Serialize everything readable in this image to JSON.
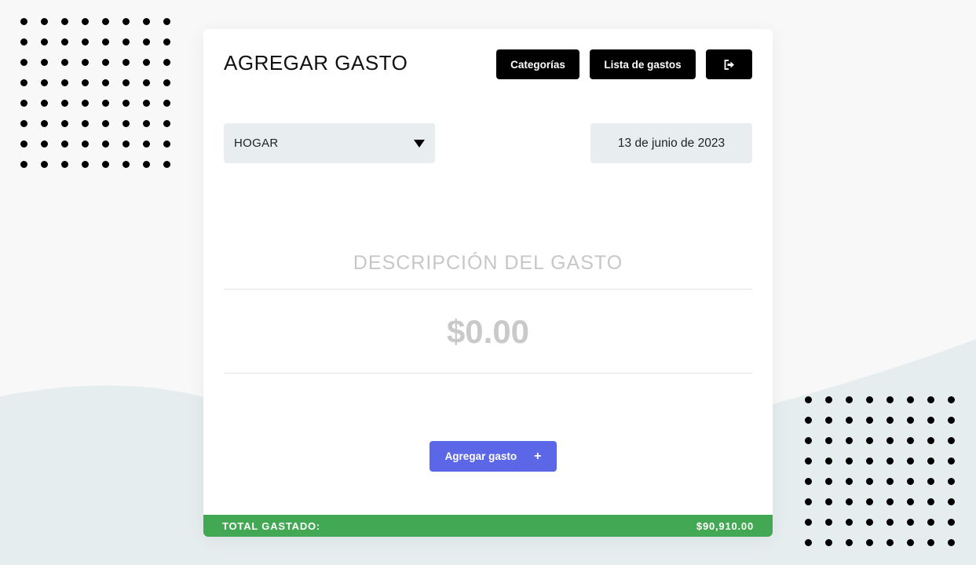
{
  "header": {
    "title": "AGREGAR GASTO",
    "categories_label": "Categorías",
    "expense_list_label": "Lista de gastos",
    "logout_icon": "sign-out-icon"
  },
  "form": {
    "category_value": "HOGAR",
    "date_value": "13 de junio de 2023",
    "description_placeholder": "DESCRIPCIÓN DEL GASTO",
    "amount_placeholder": "$0.00",
    "submit_label": "Agregar gasto",
    "submit_icon": "+"
  },
  "footer": {
    "total_label": "TOTAL GASTADO:",
    "total_value": "$90,910.00"
  },
  "colors": {
    "background": "#f8f8f8",
    "wave": "#e6edef",
    "card": "#ffffff",
    "dark_button": "#000000",
    "field_background": "#e8eeef",
    "primary_button": "#5b67e6",
    "total_bar": "#43a853"
  }
}
